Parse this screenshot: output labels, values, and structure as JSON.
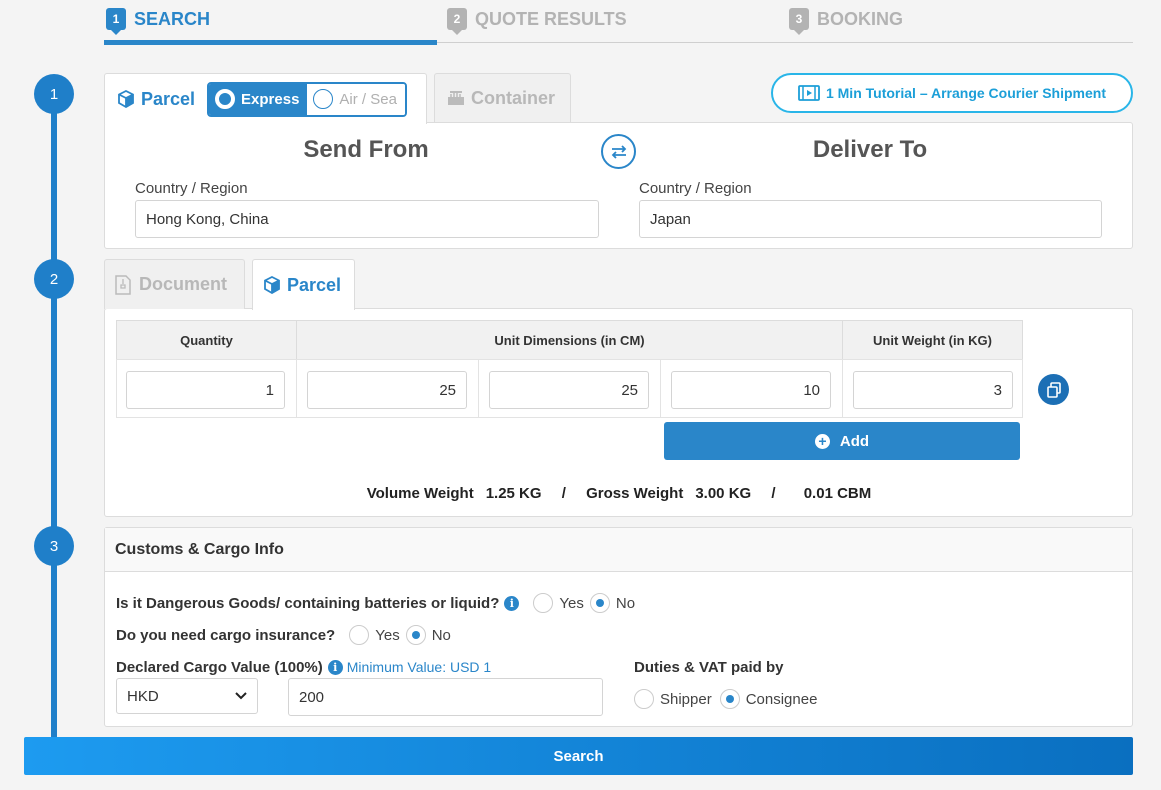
{
  "steps": [
    {
      "num": "1",
      "label": "SEARCH"
    },
    {
      "num": "2",
      "label": "QUOTE RESULTS"
    },
    {
      "num": "3",
      "label": "BOOKING"
    }
  ],
  "progress": [
    "1",
    "2",
    "3"
  ],
  "section1": {
    "tab_parcel": "Parcel",
    "mode_express": "Express",
    "mode_air_sea": "Air / Sea",
    "tab_container": "Container",
    "tutorial": "1 Min Tutorial – Arrange Courier Shipment",
    "send_from_title": "Send From",
    "deliver_to_title": "Deliver To",
    "from_label": "Country / Region",
    "from_value": "Hong Kong, China",
    "to_label": "Country / Region",
    "to_value": "Japan"
  },
  "section2": {
    "tab_document": "Document",
    "tab_parcel": "Parcel",
    "headers": {
      "quantity": "Quantity",
      "dimensions": "Unit Dimensions (in CM)",
      "weight": "Unit Weight (in KG)"
    },
    "row": {
      "quantity": "1",
      "length": "25",
      "width": "25",
      "height": "10",
      "weight": "3"
    },
    "add_label": "Add",
    "volume_weight_label": "Volume Weight",
    "volume_weight_value": "1.25 KG",
    "separator": "/",
    "gross_weight_label": "Gross Weight",
    "gross_weight_value": "3.00 KG",
    "cbm_value": "0.01 CBM"
  },
  "section3": {
    "title": "Customs & Cargo Info",
    "dangerous_q": "Is it Dangerous Goods/ containing batteries or liquid?",
    "insurance_q": "Do you need cargo insurance?",
    "yes": "Yes",
    "no": "No",
    "declared_label": "Declared Cargo Value (100%)",
    "declared_hint": "Minimum Value: USD 1",
    "currency": "HKD",
    "declared_value": "200",
    "duties_label": "Duties & VAT paid by",
    "shipper": "Shipper",
    "consignee": "Consignee"
  },
  "search_label": "Search",
  "colors": {
    "primary": "#2a86c9",
    "progress": "#1f7fc9",
    "tutorial": "#29b5e8"
  }
}
